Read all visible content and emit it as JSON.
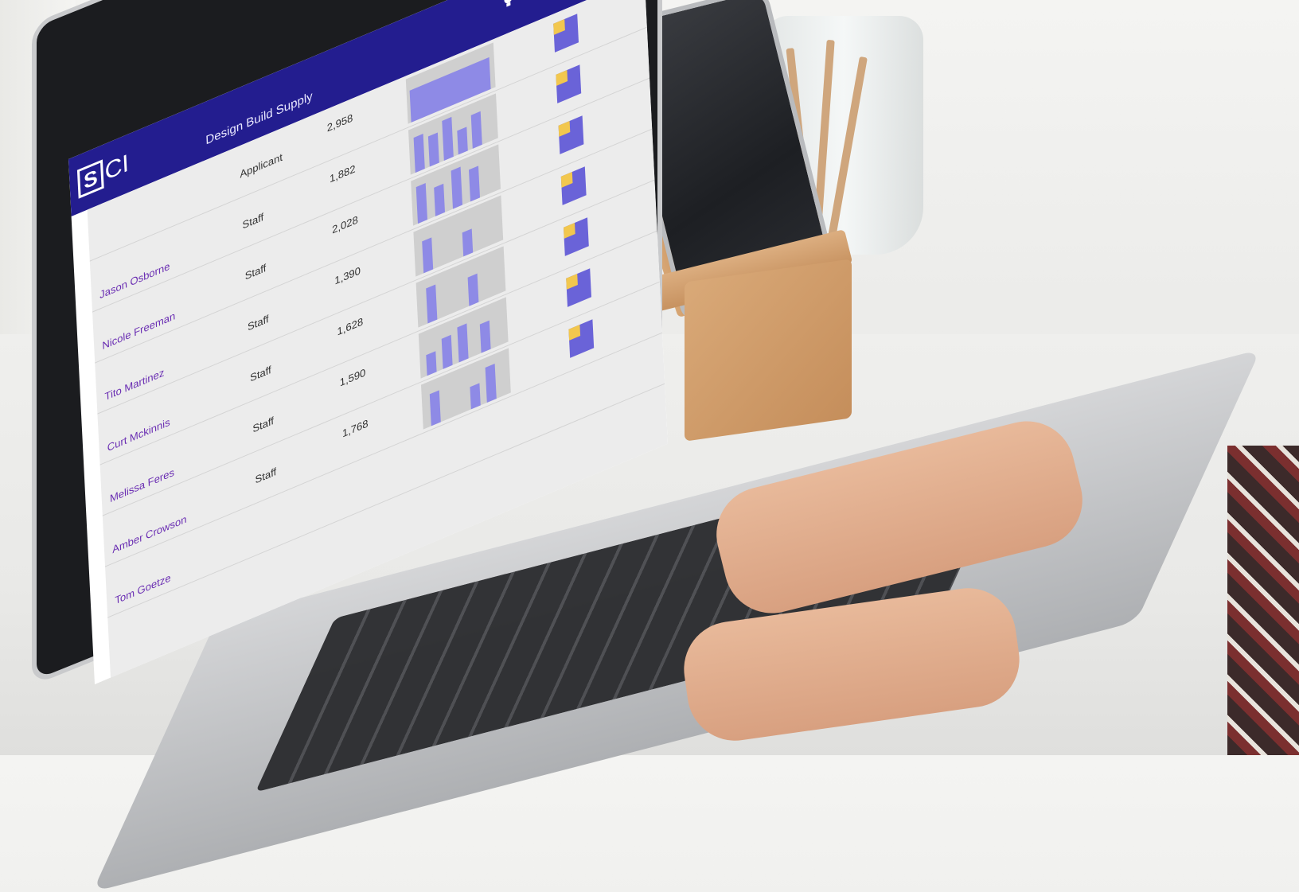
{
  "app": {
    "title": "Design Build Supply",
    "logo": {
      "s_letter": "S",
      "ci_letters": "CI"
    },
    "toolbar_icons": [
      "lightbulb-icon",
      "contacts-book-icon",
      "bank-icon",
      "gear-icon",
      "sign-out-icon"
    ]
  },
  "colors": {
    "appbar": "#231d8f",
    "name_link": "#6b2fb3",
    "bar": "#8e8ae6",
    "square": "#6a63d8",
    "square_corner": "#f2c74e"
  },
  "rows": [
    {
      "name": "",
      "role": "Applicant",
      "score": "2,958"
    },
    {
      "name": "Jason Osborne",
      "role": "Staff",
      "score": "1,882"
    },
    {
      "name": "Nicole Freeman",
      "role": "Staff",
      "score": "2,028"
    },
    {
      "name": "Tito Martinez",
      "role": "Staff",
      "score": "1,390"
    },
    {
      "name": "Curt Mckinnis",
      "role": "Staff",
      "score": "1,628"
    },
    {
      "name": "Melissa Feres",
      "role": "Staff",
      "score": "1,590"
    },
    {
      "name": "Amber Crowson",
      "role": "Staff",
      "score": "1,768"
    },
    {
      "name": "Tom Goetze",
      "role": "",
      "score": ""
    }
  ]
}
